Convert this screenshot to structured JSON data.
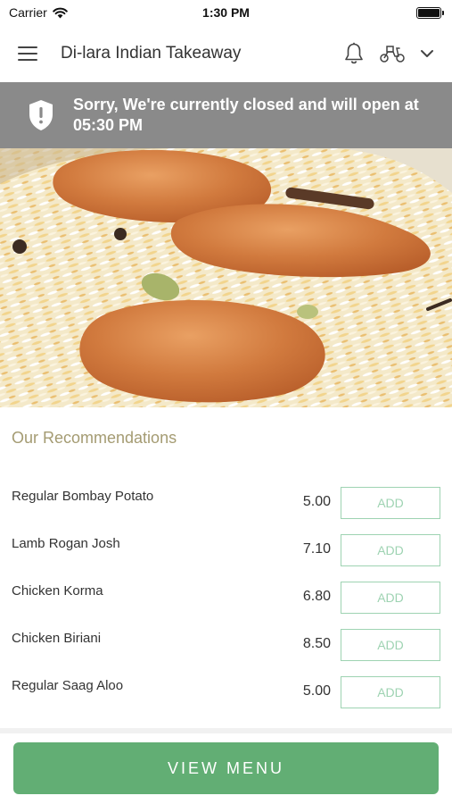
{
  "status_bar": {
    "carrier": "Carrier",
    "time": "1:30 PM"
  },
  "header": {
    "title": "Di-lara Indian Takeaway",
    "icons": [
      "hamburger-menu-icon",
      "bell-icon",
      "delivery-scooter-icon",
      "chevron-down-icon"
    ]
  },
  "banner": {
    "message": "Sorry, We're currently closed and will open at 05:30 PM",
    "icon": "shield-alert-icon",
    "background": "#8a8a8a"
  },
  "recommendations": {
    "title": "Our Recommendations",
    "items": [
      {
        "name": "Regular Bombay Potato",
        "price": "5.00",
        "button": "ADD"
      },
      {
        "name": "Lamb Rogan Josh",
        "price": "7.10",
        "button": "ADD"
      },
      {
        "name": "Chicken Korma",
        "price": "6.80",
        "button": "ADD"
      },
      {
        "name": "Chicken Biriani",
        "price": "8.50",
        "button": "ADD"
      },
      {
        "name": "Regular Saag Aloo",
        "price": "5.00",
        "button": "ADD"
      }
    ]
  },
  "footer": {
    "view_menu_label": "VIEW MENU"
  },
  "colors": {
    "accent_green": "#62ae74",
    "add_button_green": "#9ed3b2",
    "section_title": "#a49b72"
  }
}
